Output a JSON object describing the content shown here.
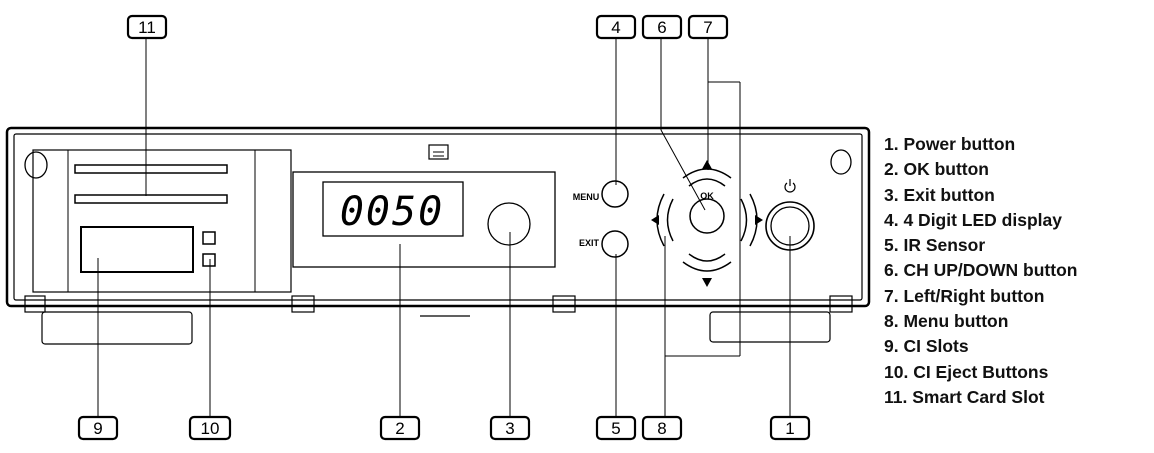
{
  "display": {
    "digits": "0050"
  },
  "buttons": {
    "menu_label": "MENU",
    "exit_label": "EXIT",
    "ok_label": "OK"
  },
  "callouts": {
    "c1": "1",
    "c2": "2",
    "c3": "3",
    "c4": "4",
    "c5": "5",
    "c6": "6",
    "c7": "7",
    "c8": "8",
    "c9": "9",
    "c10": "10",
    "c11": "11"
  },
  "legend": [
    "1. Power button",
    "2. OK button",
    "3. Exit button",
    "4. 4 Digit LED display",
    "5. IR Sensor",
    "6. CH UP/DOWN button",
    "7. Left/Right button",
    "8. Menu button",
    "9. CI Slots",
    "10. CI Eject Buttons",
    "11. Smart Card Slot"
  ]
}
